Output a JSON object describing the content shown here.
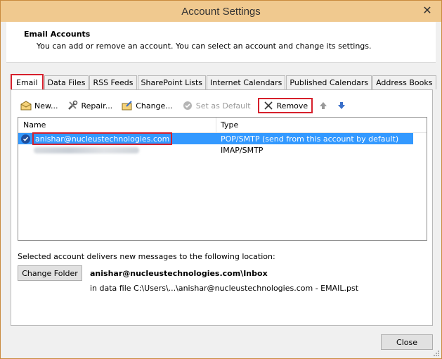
{
  "window": {
    "title": "Account Settings",
    "close_glyph": "✕"
  },
  "header": {
    "title": "Email Accounts",
    "description": "You can add or remove an account. You can select an account and change its settings."
  },
  "tabs": [
    {
      "label": "Email",
      "active": true
    },
    {
      "label": "Data Files"
    },
    {
      "label": "RSS Feeds"
    },
    {
      "label": "SharePoint Lists"
    },
    {
      "label": "Internet Calendars"
    },
    {
      "label": "Published Calendars"
    },
    {
      "label": "Address Books"
    }
  ],
  "toolbar": {
    "new_label": "New...",
    "repair_label": "Repair...",
    "change_label": "Change...",
    "set_default_label": "Set as Default",
    "remove_label": "Remove"
  },
  "list": {
    "columns": {
      "name": "Name",
      "type": "Type"
    },
    "rows": [
      {
        "name": "anishar@nucleustechnologies.com",
        "type": "POP/SMTP (send from this account by default)"
      },
      {
        "name": "",
        "type": "IMAP/SMTP"
      }
    ]
  },
  "delivery": {
    "label": "Selected account delivers new messages to the following location:",
    "change_folder_label": "Change Folder",
    "inbox_path": "anishar@nucleustechnologies.com\\Inbox",
    "data_file": "in data file C:\\Users\\...\\anishar@nucleustechnologies.com - EMAIL.pst"
  },
  "footer": {
    "close_label": "Close"
  },
  "colors": {
    "accent_red": "#d6202c",
    "selection": "#3399ff",
    "titlebar": "#f0c98f"
  }
}
